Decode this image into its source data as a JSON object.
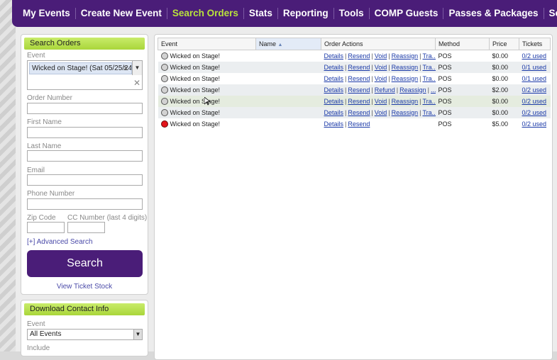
{
  "nav": {
    "items": [
      "My Events",
      "Create New Event",
      "Search Orders",
      "Stats",
      "Reporting",
      "Tools",
      "COMP Guests",
      "Passes & Packages",
      "Seating Maps"
    ],
    "active_index": 2
  },
  "search_panel": {
    "title": "Search Orders",
    "event_label": "Event",
    "event_selected": "Wicked on Stage! (Sat 05/25/24",
    "order_number_label": "Order Number",
    "first_name_label": "First Name",
    "last_name_label": "Last Name",
    "email_label": "Email",
    "phone_label": "Phone Number",
    "zip_label": "Zip Code",
    "cc_label": "CC Number (last 4 digits)",
    "advanced_search": "[+] Advanced Search",
    "search_button": "Search",
    "view_ticket_stock": "View Ticket Stock"
  },
  "download_panel": {
    "title": "Download Contact Info",
    "event_label": "Event",
    "event_value": "All Events",
    "include_label": "Include"
  },
  "results": {
    "headers": [
      "Event",
      "Name",
      "Order Actions",
      "Method",
      "Price",
      "Tickets"
    ],
    "rows": [
      {
        "event": "Wicked on Stage!",
        "name": "",
        "actions": [
          "Details",
          "Resend",
          "Void",
          "Reassign",
          "Tra..."
        ],
        "method": "POS",
        "price": "$0.00",
        "tickets": "0/2 used",
        "status": "gray"
      },
      {
        "event": "Wicked on Stage!",
        "name": "",
        "actions": [
          "Details",
          "Resend",
          "Void",
          "Reassign",
          "Tra..."
        ],
        "method": "POS",
        "price": "$0.00",
        "tickets": "0/1 used",
        "status": "gray"
      },
      {
        "event": "Wicked on Stage!",
        "name": "",
        "actions": [
          "Details",
          "Resend",
          "Void",
          "Reassign",
          "Tra..."
        ],
        "method": "POS",
        "price": "$0.00",
        "tickets": "0/1 used",
        "status": "gray"
      },
      {
        "event": "Wicked on Stage!",
        "name": "",
        "actions": [
          "Details",
          "Resend",
          "Refund",
          "Reassign",
          "..."
        ],
        "method": "POS",
        "price": "$2.00",
        "tickets": "0/2 used",
        "status": "gray"
      },
      {
        "event": "Wicked on Stage!",
        "name": "",
        "actions": [
          "Details",
          "Resend",
          "Void",
          "Reassign",
          "Tra..."
        ],
        "method": "POS",
        "price": "$0.00",
        "tickets": "0/2 used",
        "status": "gray"
      },
      {
        "event": "Wicked on Stage!",
        "name": "",
        "actions": [
          "Details",
          "Resend",
          "Void",
          "Reassign",
          "Tra..."
        ],
        "method": "POS",
        "price": "$0.00",
        "tickets": "0/2 used",
        "status": "gray"
      },
      {
        "event": "Wicked on Stage!",
        "name": "",
        "actions": [
          "Details",
          "Resend"
        ],
        "method": "POS",
        "price": "$5.00",
        "tickets": "0/2 used",
        "status": "red"
      }
    ]
  },
  "colors": {
    "nav_bg": "#4a1d78",
    "nav_active": "#b9e23c",
    "panel_header": "#b5dc4a",
    "link": "#1b3aa8"
  },
  "icons": [
    "sort-asc-icon",
    "dropdown-arrow-icon",
    "clear-x-icon",
    "status-dot-icon"
  ]
}
